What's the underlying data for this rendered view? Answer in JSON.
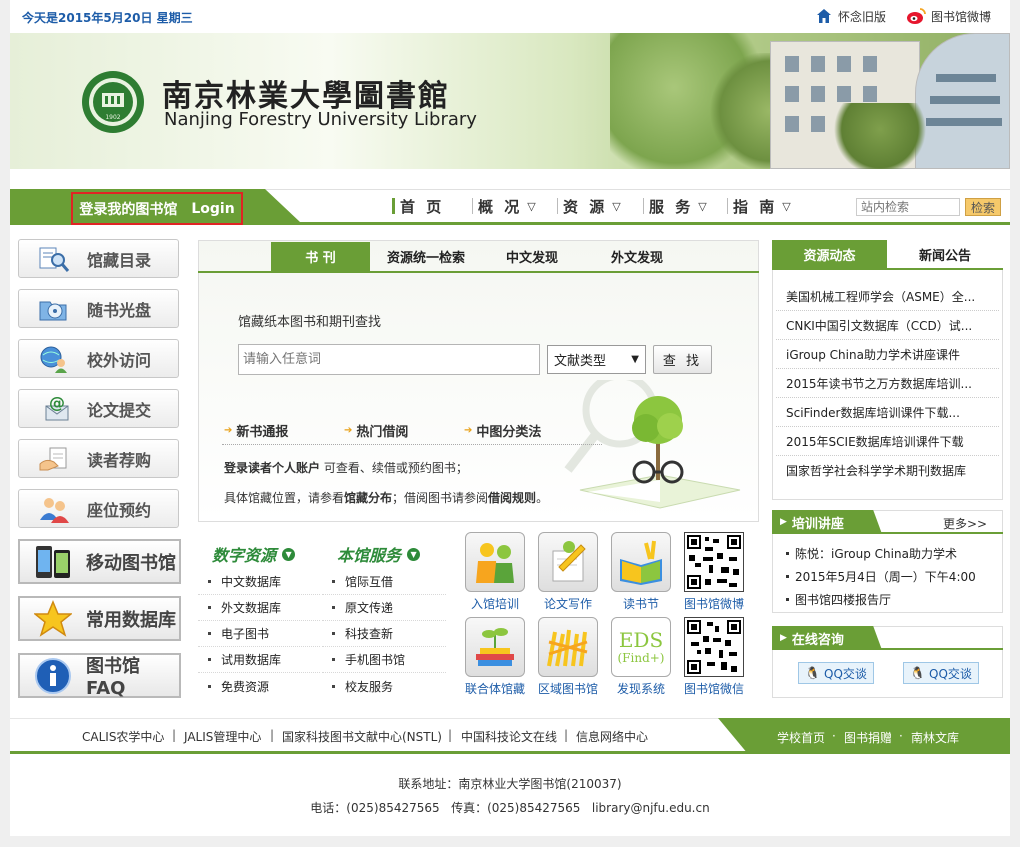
{
  "topbar": {
    "date": "今天是2015年5月20日 星期三",
    "old_version": "怀念旧版",
    "weibo": "图书馆微博"
  },
  "banner": {
    "title_cn": "南京林業大學圖書館",
    "title_en": "Nanjing Forestry University Library",
    "seal_year": "1902"
  },
  "login": {
    "label": "登录我的图书馆",
    "login": "Login"
  },
  "nav": [
    "首 页",
    "概 况",
    "资 源",
    "服 务",
    "指 南"
  ],
  "site_search": {
    "placeholder": "站内检索",
    "button": "检索"
  },
  "left_buttons": [
    "馆藏目录",
    "随书光盘",
    "校外访问",
    "论文提交",
    "读者荐购",
    "座位预约"
  ],
  "left_big_buttons": [
    "移动图书馆",
    "常用数据库",
    "图书馆FAQ"
  ],
  "search_panel": {
    "tabs": [
      "书 刊",
      "资源统一检索",
      "中文发现",
      "外文发现"
    ],
    "title": "馆藏纸本图书和期刊查找",
    "input_placeholder": "请输入任意词",
    "select_value": "文献类型",
    "button": "查 找",
    "quick_links": [
      "新书通报",
      "热门借阅",
      "中图分类法"
    ],
    "note1_bold": "登录读者个人账户",
    "note1_rest": " 可查看、续借或预约图书；",
    "note2_a": "具体馆藏位置，请参看",
    "note2_b": "馆藏分布",
    "note2_c": "；借阅图书请参阅",
    "note2_d": "借阅规则",
    "note2_e": "。"
  },
  "digital": {
    "heading": "数字资源",
    "items": [
      "中文数据库",
      "外文数据库",
      "电子图书",
      "试用数据库",
      "免费资源"
    ]
  },
  "services": {
    "heading": "本馆服务",
    "items": [
      "馆际互借",
      "原文传递",
      "科技查新",
      "手机图书馆",
      "校友服务"
    ]
  },
  "icon_tiles": {
    "row1": [
      "入馆培训",
      "论文写作",
      "读书节",
      "图书馆微博"
    ],
    "row2": [
      "联合体馆藏",
      "区域图书馆",
      "发现系统",
      "图书馆微信"
    ],
    "eds_text": "EDS",
    "eds_sub": "(Find+)"
  },
  "right_tabs": [
    "资源动态",
    "新闻公告"
  ],
  "news": [
    "美国机械工程师学会（ASME）全...",
    "CNKI中国引文数据库（CCD）试...",
    "iGroup China助力学术讲座课件",
    "2015年读书节之万方数据库培训...",
    "SciFinder数据库培训课件下载...",
    "2015年SCIE数据库培训课件下载",
    "国家哲学社会科学学术期刊数据库"
  ],
  "training": {
    "heading": "培训讲座",
    "more": "更多>>",
    "lines": [
      "陈悦：iGroup China助力学术",
      "2015年5月4日（周一）下午4:00",
      "图书馆四楼报告厅"
    ]
  },
  "consult": {
    "heading": "在线咨询",
    "qq1": "QQ交谈",
    "qq2": "QQ交谈"
  },
  "footer_links": [
    "CALIS农学中心",
    "JALIS管理中心",
    "国家科技图书文献中心(NSTL)",
    "中国科技论文在线",
    "信息网络中心"
  ],
  "footer_green": [
    "学校首页",
    "图书捐赠",
    "南林文库"
  ],
  "footer": {
    "address": "联系地址：南京林业大学图书馆(210037)",
    "contact": "电话：(025)85427565   传真：(025)85427565   library@njfu.edu.cn"
  },
  "colors": {
    "brand_green": "#6a9e36",
    "link_blue": "#1d5ca8",
    "highlight_red": "#e02424"
  }
}
